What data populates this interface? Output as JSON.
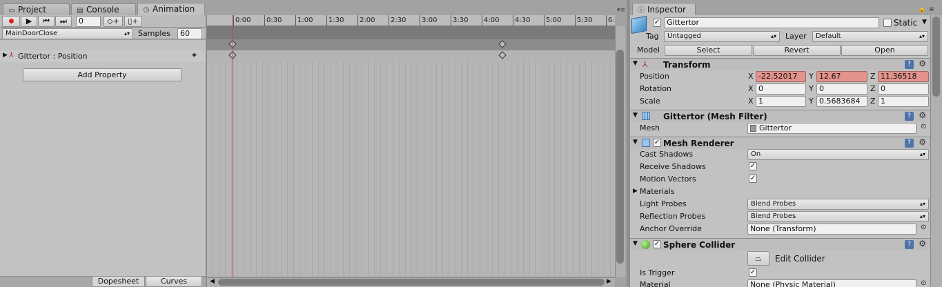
{
  "tabs": [
    {
      "label": "Project",
      "icon": "folder-icon"
    },
    {
      "label": "Console",
      "icon": "console-icon"
    },
    {
      "label": "Animation",
      "icon": "clock-icon"
    }
  ],
  "anim": {
    "frame": "0",
    "clip": "MainDoorClose",
    "samples_label": "Samples",
    "samples_value": "60",
    "property": "Gittertor : Position",
    "add_property": "Add Property",
    "dopesheet": "Dopesheet",
    "curves": "Curves",
    "ticks": [
      "0:00",
      "0:30",
      "1:00",
      "1:30",
      "2:00",
      "2:30",
      "3:00",
      "3:30",
      "4:00",
      "4:30",
      "5:00",
      "5:30",
      "6:"
    ],
    "keyframe_times": [
      "0:00",
      "4:10"
    ]
  },
  "inspector": {
    "tab": "Inspector",
    "object_name": "Gittertor",
    "static_label": "Static",
    "tag_label": "Tag",
    "tag_value": "Untagged",
    "layer_label": "Layer",
    "layer_value": "Default",
    "model_label": "Model",
    "select": "Select",
    "revert": "Revert",
    "open": "Open",
    "transform": {
      "title": "Transform",
      "position_label": "Position",
      "rotation_label": "Rotation",
      "scale_label": "Scale",
      "position": {
        "x": "-22.52017",
        "y": "12.67",
        "z": "11.36518"
      },
      "rotation": {
        "x": "0",
        "y": "0",
        "z": "0"
      },
      "scale": {
        "x": "1",
        "y": "0.5683684",
        "z": "1"
      }
    },
    "mesh_filter": {
      "title": "Gittertor (Mesh Filter)",
      "mesh_label": "Mesh",
      "mesh_value": "Gittertor"
    },
    "mesh_renderer": {
      "title": "Mesh Renderer",
      "cast_shadows_label": "Cast Shadows",
      "cast_shadows_value": "On",
      "receive_shadows_label": "Receive Shadows",
      "motion_vectors_label": "Motion Vectors",
      "materials_label": "Materials",
      "light_probes_label": "Light Probes",
      "light_probes_value": "Blend Probes",
      "reflection_probes_label": "Reflection Probes",
      "reflection_probes_value": "Blend Probes",
      "anchor_override_label": "Anchor Override",
      "anchor_override_value": "None (Transform)"
    },
    "sphere_collider": {
      "title": "Sphere Collider",
      "edit_collider": "Edit Collider",
      "is_trigger_label": "Is Trigger",
      "material_label": "Material",
      "material_value": "None (Physic Material)"
    }
  },
  "colors": {
    "recording_red": "#e02020",
    "playhead": "#e03030",
    "animated_field": "#e3928c"
  }
}
